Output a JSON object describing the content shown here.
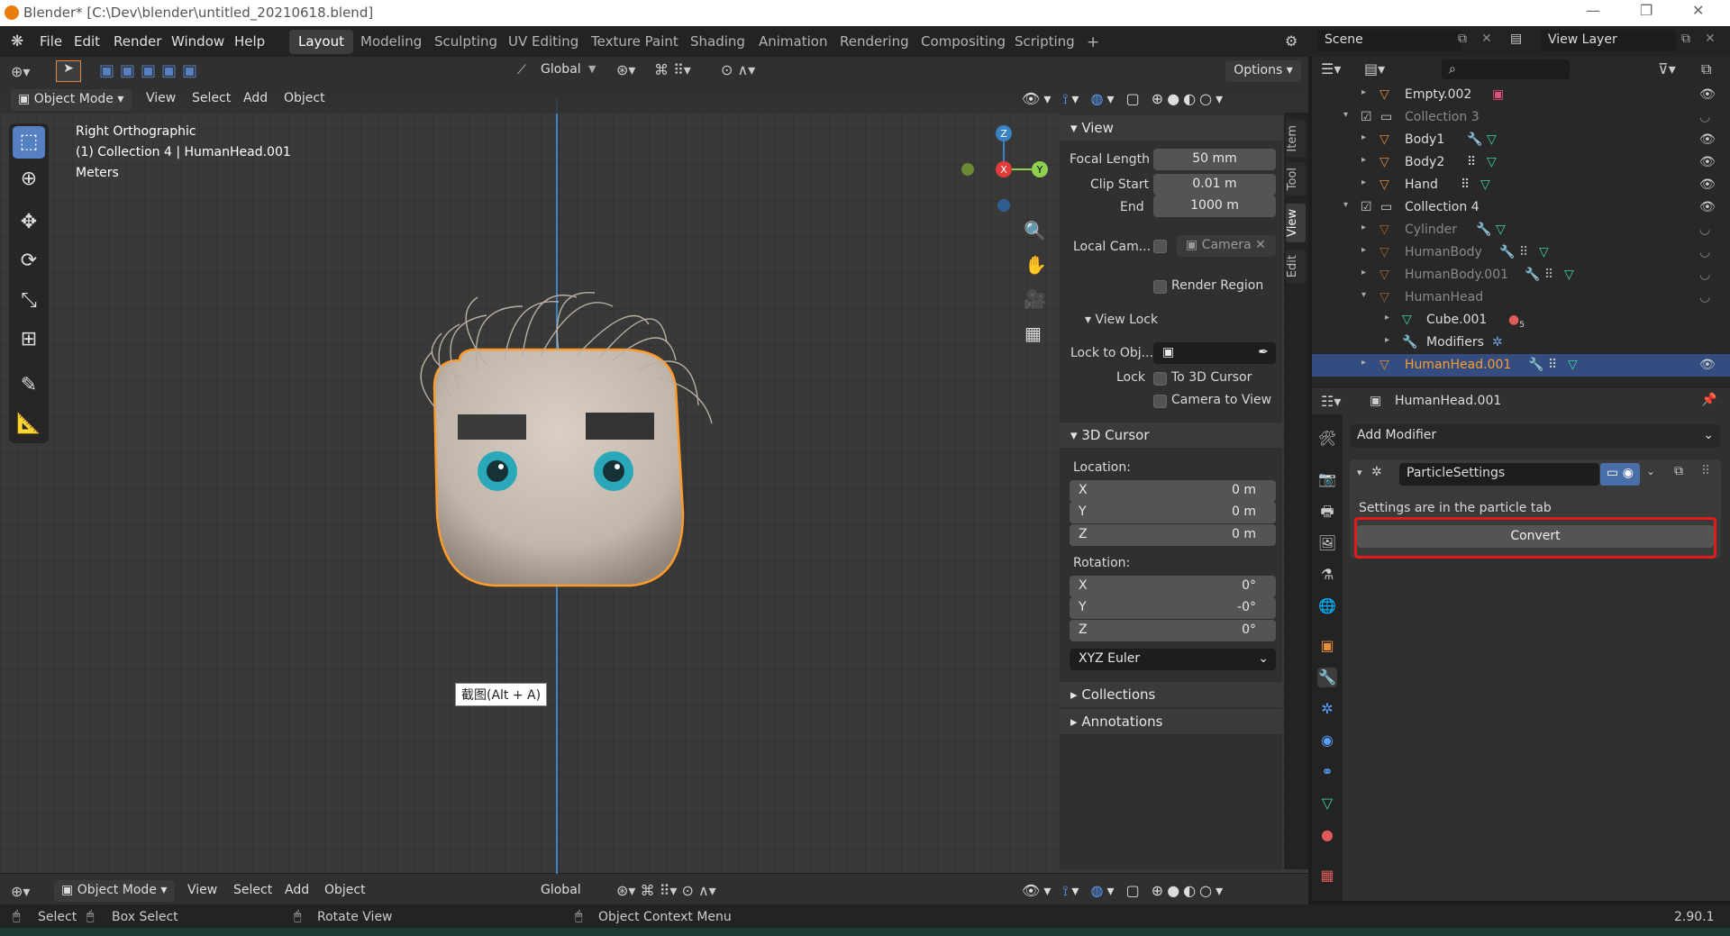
{
  "titlebar": {
    "title": "Blender* [C:\\Dev\\blender\\untitled_20210618.blend]"
  },
  "menus": [
    "File",
    "Edit",
    "Render",
    "Window",
    "Help"
  ],
  "workspaces": [
    "Layout",
    "Modeling",
    "Sculpting",
    "UV Editing",
    "Texture Paint",
    "Shading",
    "Animation",
    "Rendering",
    "Compositing",
    "Scripting"
  ],
  "workspace_add": "+",
  "scene": {
    "label": "Scene",
    "view_layer": "View Layer"
  },
  "viewport": {
    "transform_orientation": "Global",
    "options": "Options",
    "mode": "Object Mode",
    "menus": [
      "View",
      "Select",
      "Add",
      "Object"
    ],
    "overlay_lines": [
      "Right Orthographic",
      "(1) Collection 4 | HumanHead.001",
      "Meters"
    ],
    "gizmo_axes": {
      "z": "Z",
      "x": "X",
      "y": "Y"
    },
    "tooltip": "截图(Alt + A)"
  },
  "npanel": {
    "tabs": [
      "Item",
      "Tool",
      "View",
      "Edit"
    ],
    "view_section": "View",
    "focal_length_label": "Focal Length",
    "focal_length": "50 mm",
    "clip_start_label": "Clip Start",
    "clip_start": "0.01 m",
    "end_label": "End",
    "end": "1000 m",
    "local_cam_label": "Local Cam...",
    "local_cam_value": "Camera",
    "render_region": "Render Region",
    "view_lock_section": "View Lock",
    "lock_to_obj_label": "Lock to Obj...",
    "lock_label": "Lock",
    "to_3d_cursor": "To 3D Cursor",
    "camera_to_view": "Camera to View",
    "cursor_section": "3D Cursor",
    "location_label": "Location:",
    "loc": [
      {
        "axis": "X",
        "val": "0 m"
      },
      {
        "axis": "Y",
        "val": "0 m"
      },
      {
        "axis": "Z",
        "val": "0 m"
      }
    ],
    "rotation_label": "Rotation:",
    "rot": [
      {
        "axis": "X",
        "val": "0°"
      },
      {
        "axis": "Y",
        "val": "-0°"
      },
      {
        "axis": "Z",
        "val": "0°"
      }
    ],
    "rotation_mode": "XYZ Euler",
    "collections_section": "Collections",
    "annotations_section": "Annotations"
  },
  "outliner": {
    "rows": [
      {
        "name": "Empty.002",
        "type": "object"
      },
      {
        "name": "Collection 3",
        "type": "collection"
      },
      {
        "name": "Body1",
        "type": "object"
      },
      {
        "name": "Body2",
        "type": "object"
      },
      {
        "name": "Hand",
        "type": "object"
      },
      {
        "name": "Collection 4",
        "type": "collection"
      },
      {
        "name": "Cylinder",
        "type": "object"
      },
      {
        "name": "HumanBody",
        "type": "object"
      },
      {
        "name": "HumanBody.001",
        "type": "object"
      },
      {
        "name": "HumanHead",
        "type": "object"
      },
      {
        "name": "Cube.001",
        "type": "child"
      },
      {
        "name": "Modifiers",
        "type": "child"
      },
      {
        "name": "HumanHead.001",
        "type": "object"
      }
    ],
    "cube_badge": "5"
  },
  "properties": {
    "object_name": "HumanHead.001",
    "add_modifier": "Add Modifier",
    "modifier_name": "ParticleSettings",
    "info_text": "Settings are in the particle tab",
    "convert_button": "Convert"
  },
  "statusbar": {
    "select": "Select",
    "box_select": "Box Select",
    "rotate_view": "Rotate View",
    "context_menu": "Object Context Menu",
    "version": "2.90.1"
  },
  "colors": {
    "accent": "#5680c2",
    "selection": "#334d80",
    "highlight": "#e21b1b",
    "object_orange": "#e3883a"
  }
}
